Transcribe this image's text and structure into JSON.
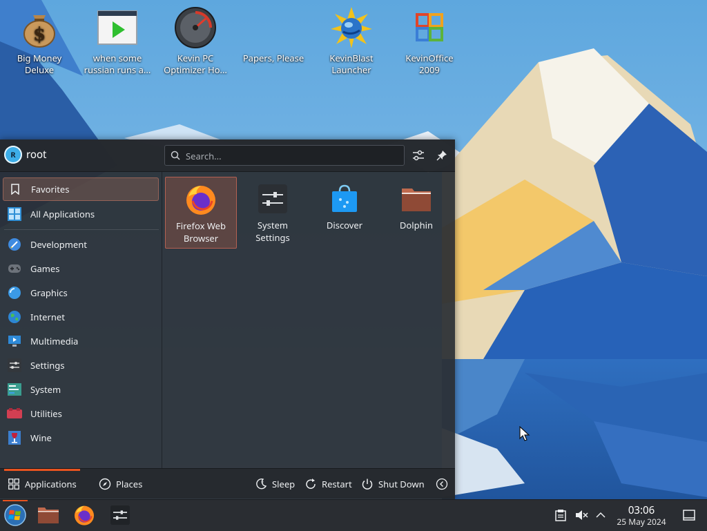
{
  "desktop": {
    "icons": [
      {
        "label": "Big Money\nDeluxe",
        "line1": "Big Money",
        "line2": "Deluxe"
      },
      {
        "label": "when some russian runs a...",
        "line1": "when some",
        "line2": "russian runs a..."
      },
      {
        "label": "Kevin PC Optimizer Ho...",
        "line1": "Kevin PC",
        "line2": "Optimizer Ho..."
      },
      {
        "label": "Papers, Please",
        "line1": "Papers, Please",
        "line2": ""
      },
      {
        "label": "KevinBlast Launcher",
        "line1": "KevinBlast",
        "line2": "Launcher"
      },
      {
        "label": "KevinOffice 2009",
        "line1": "KevinOffice",
        "line2": "2009"
      }
    ]
  },
  "menu": {
    "user": {
      "initial": "R",
      "name": "root"
    },
    "search_placeholder": "Search...",
    "categories": [
      {
        "label": "Favorites",
        "icon": "bookmark-icon"
      },
      {
        "label": "All Applications",
        "icon": "all-apps-icon"
      },
      {
        "label": "Development",
        "icon": "development-icon"
      },
      {
        "label": "Games",
        "icon": "gamepad-icon"
      },
      {
        "label": "Graphics",
        "icon": "graphics-icon"
      },
      {
        "label": "Internet",
        "icon": "globe-icon"
      },
      {
        "label": "Multimedia",
        "icon": "multimedia-icon"
      },
      {
        "label": "Settings",
        "icon": "settings-icon"
      },
      {
        "label": "System",
        "icon": "system-icon"
      },
      {
        "label": "Utilities",
        "icon": "utilities-icon"
      },
      {
        "label": "Wine",
        "icon": "wine-icon"
      }
    ],
    "apps": [
      {
        "line1": "Firefox Web",
        "line2": "Browser"
      },
      {
        "line1": "System",
        "line2": "Settings"
      },
      {
        "line1": "Discover",
        "line2": ""
      },
      {
        "line1": "Dolphin",
        "line2": ""
      }
    ],
    "footer": {
      "applications": "Applications",
      "places": "Places",
      "sleep": "Sleep",
      "restart": "Restart",
      "shutdown": "Shut Down"
    }
  },
  "taskbar": {
    "time": "03:06",
    "date": "25 May 2024"
  },
  "colors": {
    "accent": "#e95420",
    "highlight": "#3daee9",
    "panel": "#2a2d32"
  }
}
